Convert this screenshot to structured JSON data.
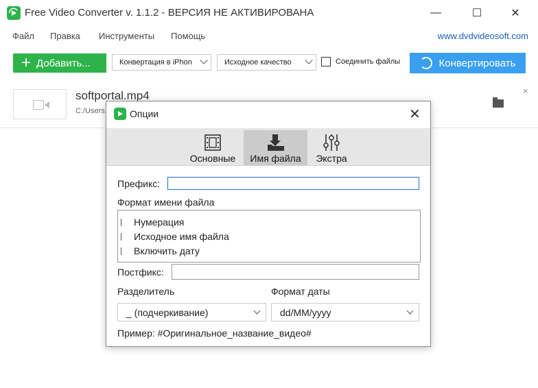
{
  "window": {
    "title": "Free Video Converter v. 1.1.2 - ВЕРСИЯ НЕ АКТИВИРОВАНА",
    "minimize": "—",
    "maximize": "☐",
    "close": "✕"
  },
  "menu": {
    "items": [
      "Файл",
      "Правка",
      "Инструменты",
      "Помощь"
    ],
    "site_link": "www.dvdvideosoft.com"
  },
  "toolbar": {
    "add_label": "Добавить...",
    "add_icon": "+",
    "preset": "Конвертация в iPhon",
    "quality": "Исходное качество",
    "merge_label": "Соединить файлы",
    "merge_checked": false,
    "convert_label": "Конвертировать"
  },
  "file": {
    "name": "softportal.mp4",
    "path": "C:/Users...",
    "remove": "×"
  },
  "dialog": {
    "title": "Опции",
    "close": "✕",
    "tabs": [
      {
        "label": "Основные",
        "icon": "film-icon",
        "active": false
      },
      {
        "label": "Имя файла",
        "icon": "download-folder-icon",
        "active": true
      },
      {
        "label": "Экстра",
        "icon": "sliders-icon",
        "active": false
      }
    ],
    "prefix_label": "Префикс:",
    "prefix_value": "",
    "format_label": "Формат имени файла",
    "format_items": [
      "Нумерация",
      "Исходное имя файла",
      "Включить дату"
    ],
    "postfix_label": "Постфикс:",
    "postfix_value": "",
    "separator_label": "Разделитель",
    "separator_value": "_ (подчеркивание)",
    "date_format_label": "Формат даты",
    "date_format_value": "dd/MM/yyyy",
    "example": "Пример: #Оригинальное_название_видео#"
  },
  "colors": {
    "green": "#2db34a",
    "blue": "#3a9ff0",
    "link": "#1a5fb4"
  }
}
